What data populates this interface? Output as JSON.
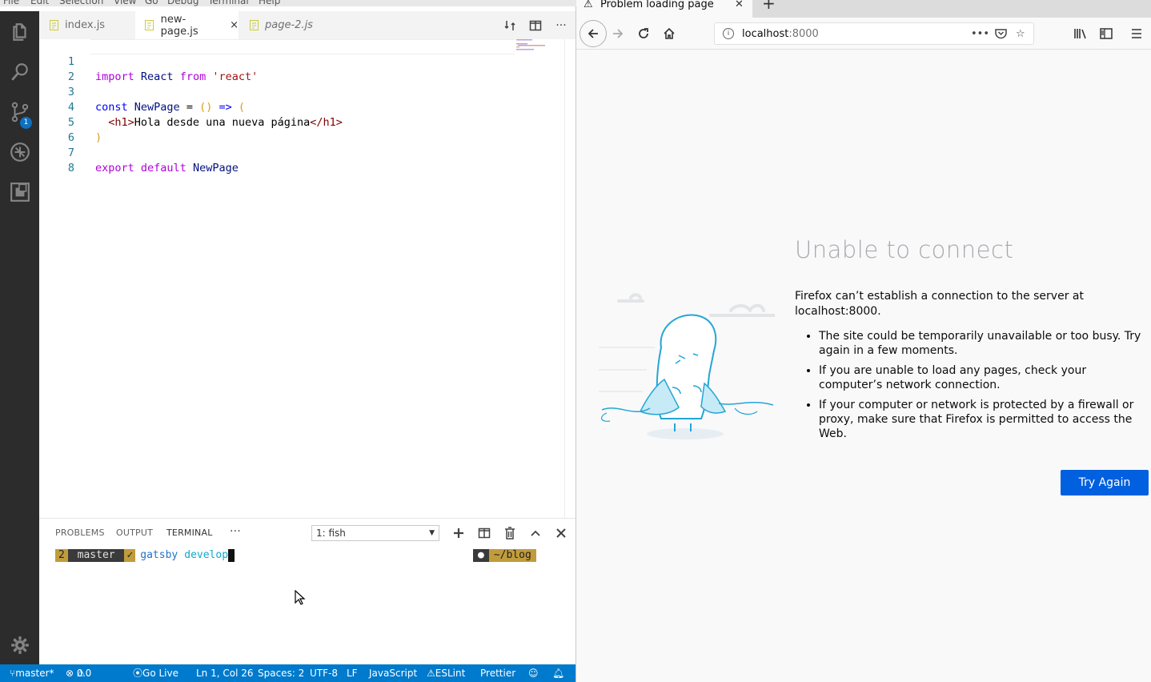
{
  "menu": [
    "File",
    "Edit",
    "Selection",
    "View",
    "Go",
    "Debug",
    "Terminal",
    "Help"
  ],
  "activity": {
    "scm_badge": "1"
  },
  "tabs": [
    {
      "label": "index.js",
      "icon": "JS"
    },
    {
      "label": "new-page.js",
      "icon": "JS",
      "close": "×"
    },
    {
      "label": "page-2.js",
      "icon": "JS"
    }
  ],
  "editor": {
    "line_numbers": [
      "1",
      "2",
      "3",
      "4",
      "5",
      "6",
      "7",
      "8"
    ],
    "line1": {
      "kw1": "import",
      "id": "React",
      "kw2": "from",
      "str": "'react'"
    },
    "line3": {
      "kw": "const",
      "id": "NewPage",
      "op": "=",
      "parens": "()",
      "arrow": "=>",
      "open": "("
    },
    "line4": {
      "open_tag": "<h1>",
      "text": "Hola desde una nueva página",
      "close_tag": "</h1>"
    },
    "line5": {
      "close": ")"
    },
    "line7": {
      "kw1": "export",
      "kw2": "default",
      "id": "NewPage"
    }
  },
  "panel": {
    "tabs": [
      "PROBLEMS",
      "OUTPUT",
      "TERMINAL"
    ],
    "more": "···",
    "terminal_select": "1: fish",
    "prompt": {
      "num": "2",
      "branch": " master ",
      "check": "✓",
      "cmd": "gatsby",
      "arg": "develop",
      "dir": "~/blog",
      "dot": "●"
    }
  },
  "status": {
    "branch": "master*",
    "errors": "0",
    "warnings": "0",
    "golive": "Go Live",
    "position": "Ln 1, Col 26",
    "spaces": "Spaces: 2",
    "encoding": "UTF-8",
    "eol": "LF",
    "language": "JavaScript",
    "eslint": "ESLint",
    "prettier": "Prettier"
  },
  "firefox": {
    "tab_title": "Problem loading page",
    "url_host": "localhost",
    "url_port": ":8000",
    "error_title": "Unable to connect",
    "error_desc": "Firefox can’t establish a connection to the server at localhost:8000.",
    "bullets": [
      "The site could be temporarily unavailable or too busy. Try again in a few moments.",
      "If you are unable to load any pages, check your computer’s network connection.",
      "If your computer or network is protected by a firewall or proxy, make sure that Firefox is permitted to access the Web."
    ],
    "try_again": "Try Again"
  },
  "colors": {
    "activitybar": "#2c2c2c",
    "statusbar": "#007acc",
    "button": "#0060df",
    "prompt_gold": "#c19c3b"
  }
}
